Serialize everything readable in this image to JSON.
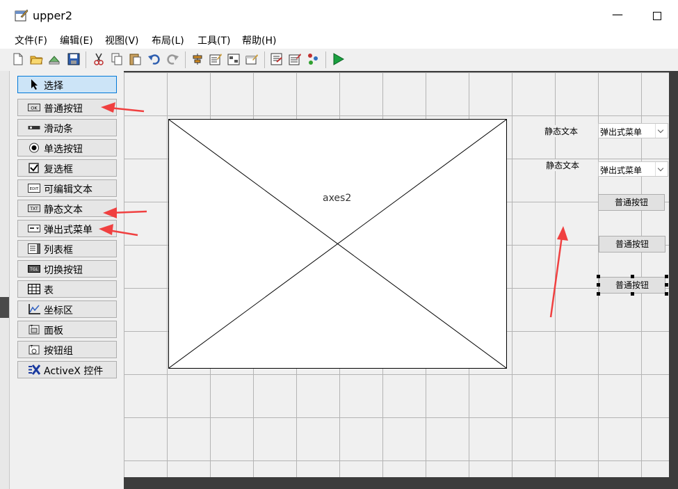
{
  "window": {
    "title": "upper2"
  },
  "menubar": {
    "items": [
      "文件(F)",
      "编辑(E)",
      "视图(V)",
      "布局(L)",
      "工具(T)",
      "帮助(H)"
    ]
  },
  "toolbar": {
    "icons": [
      "new-file-icon",
      "open-folder-icon",
      "export-icon",
      "save-icon",
      "cut-icon",
      "copy-icon",
      "paste-icon",
      "undo-icon",
      "redo-icon",
      "align-icon",
      "menu-editor-icon",
      "tab-order-icon",
      "toolbar-editor-icon",
      "mfile-editor-icon",
      "property-inspector-icon",
      "object-browser-icon",
      "run-icon"
    ]
  },
  "palette": {
    "items": [
      {
        "label": "选择",
        "icon": "pointer-icon"
      },
      {
        "label": "普通按钮",
        "icon": "pushbutton-icon",
        "icon_text": "OK"
      },
      {
        "label": "滑动条",
        "icon": "slider-icon"
      },
      {
        "label": "单选按钮",
        "icon": "radio-icon"
      },
      {
        "label": "复选框",
        "icon": "checkbox-icon"
      },
      {
        "label": "可编辑文本",
        "icon": "edit-text-icon",
        "icon_text": "EDIT"
      },
      {
        "label": "静态文本",
        "icon": "static-text-icon",
        "icon_text": "TXT"
      },
      {
        "label": "弹出式菜单",
        "icon": "popup-menu-icon"
      },
      {
        "label": "列表框",
        "icon": "listbox-icon"
      },
      {
        "label": "切换按钮",
        "icon": "toggle-button-icon",
        "icon_text": "TGL"
      },
      {
        "label": "表",
        "icon": "table-icon"
      },
      {
        "label": "坐标区",
        "icon": "axes-icon"
      },
      {
        "label": "面板",
        "icon": "panel-icon"
      },
      {
        "label": "按钮组",
        "icon": "button-group-icon"
      },
      {
        "label": "ActiveX 控件",
        "icon": "activex-icon"
      }
    ]
  },
  "canvas": {
    "axes_label": "axes2",
    "static_text_1": "静态文本",
    "static_text_2": "静态文本",
    "popup_1": "弹出式菜单",
    "popup_2": "弹出式菜单",
    "button_1": "普通按钮",
    "button_2": "普通按钮",
    "button_3": "普通按钮"
  },
  "colors": {
    "annotation_arrow": "#f04040",
    "selected_tool": "#cce4f7"
  }
}
